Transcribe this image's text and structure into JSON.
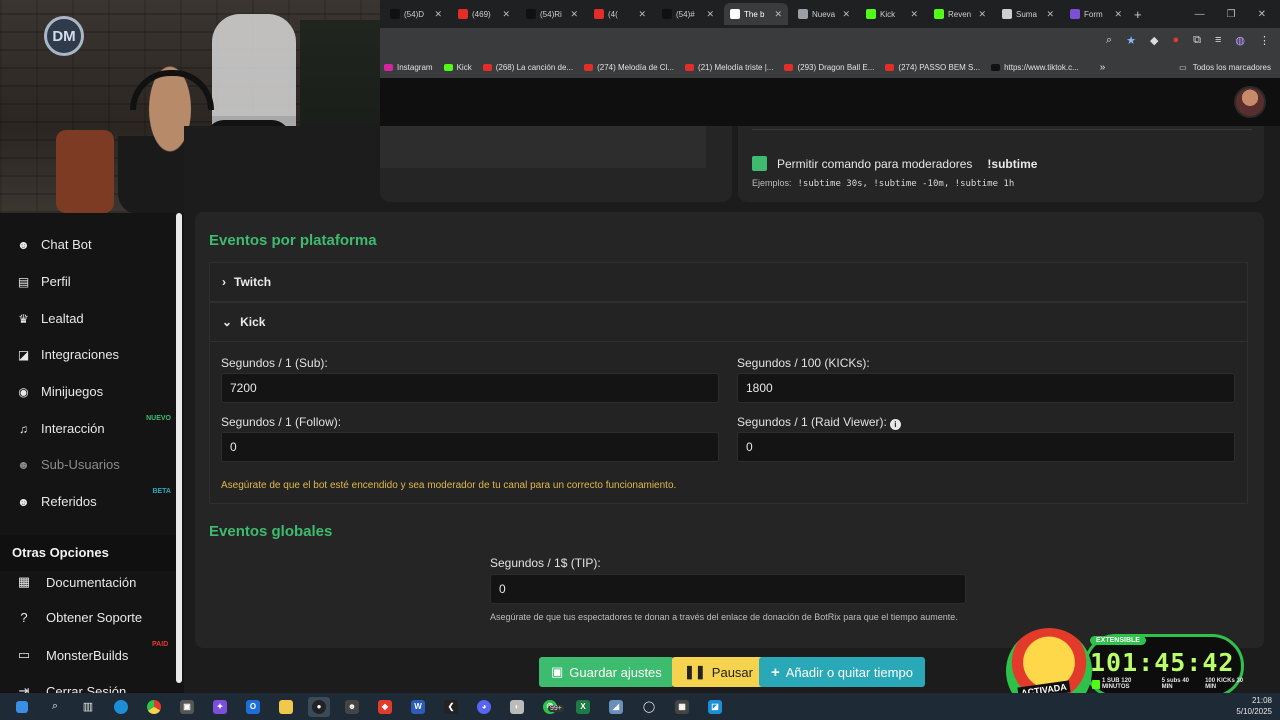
{
  "browser": {
    "tabs": [
      {
        "label": "(54)D",
        "color": "#111111",
        "icon": "tiktok-icon"
      },
      {
        "label": "(469)",
        "color": "#e52d27",
        "icon": "youtube-icon"
      },
      {
        "label": "(54)Ri",
        "color": "#111111",
        "icon": "tiktok-icon"
      },
      {
        "label": "(4(",
        "color": "#e52d27",
        "icon": "youtube-icon"
      },
      {
        "label": "(54)#",
        "color": "#111111",
        "icon": "tiktok-icon"
      },
      {
        "label": "The b",
        "color": "#ffffff",
        "icon": "botrix-icon",
        "active": true
      },
      {
        "label": "Nueva",
        "color": "#9aa0a6",
        "icon": "chrome-icon"
      },
      {
        "label": "Kick",
        "color": "#53fc18",
        "icon": "kick-icon"
      },
      {
        "label": "Reven",
        "color": "#53fc18",
        "icon": "kick-icon"
      },
      {
        "label": "Suma",
        "color": "#cfcfcf",
        "icon": "openai-icon"
      },
      {
        "label": "Form",
        "color": "#7b4fd6",
        "icon": "forms-icon"
      }
    ],
    "bookmarks": [
      {
        "label": "Instagram",
        "color": "#d6249f"
      },
      {
        "label": "Kick",
        "color": "#53fc18"
      },
      {
        "label": "(268) La canción de...",
        "color": "#e52d27"
      },
      {
        "label": "(274) Melodía de Cl...",
        "color": "#e52d27"
      },
      {
        "label": "(21) Melodía triste |...",
        "color": "#e52d27"
      },
      {
        "label": "(293) Dragon Ball E...",
        "color": "#e52d27"
      },
      {
        "label": "(274) PASSO BEM S...",
        "color": "#e52d27"
      },
      {
        "label": "https://www.tiktok.c...",
        "color": "#111111"
      }
    ],
    "all_bookmarks": "Todos los marcadores",
    "more_bookmarks": "»"
  },
  "webcam": {
    "logo_text": "DM"
  },
  "sidebar": {
    "items": [
      {
        "label": "Chat Bot",
        "icon": "robot-icon",
        "glyph": "☻"
      },
      {
        "label": "Perfil",
        "icon": "id-card-icon",
        "glyph": "▤"
      },
      {
        "label": "Lealtad",
        "icon": "trophy-icon",
        "glyph": "♛"
      },
      {
        "label": "Integraciones",
        "icon": "integration-icon",
        "glyph": "◪"
      },
      {
        "label": "Minijuegos",
        "icon": "gamepad-icon",
        "glyph": "◉"
      },
      {
        "label": "Interacción",
        "icon": "music-icon",
        "glyph": "♫",
        "badge": "NUEVO",
        "badge_color": "#3dbb6e"
      },
      {
        "label": "Sub-Usuarios",
        "icon": "users-icon",
        "glyph": "☻",
        "disabled": true
      },
      {
        "label": "Referidos",
        "icon": "users-icon",
        "glyph": "☻",
        "badge": "BETA",
        "badge_color": "#29a8b8"
      }
    ],
    "other_options_title": "Otras Opciones",
    "other_options": [
      {
        "label": "Documentación",
        "icon": "document-icon",
        "glyph": "▦"
      },
      {
        "label": "Obtener Soporte",
        "icon": "help-icon",
        "glyph": "?"
      },
      {
        "label": "MonsterBuilds",
        "icon": "monitor-icon",
        "glyph": "▭",
        "badge": "PAID",
        "badge_color": "#e33b2b"
      },
      {
        "label": "Cerrar Sesión",
        "icon": "logout-icon",
        "glyph": "⇥"
      }
    ]
  },
  "moderator": {
    "checkbox_label": "Permitir comando para moderadores",
    "command": "!subtime",
    "examples_label": "Ejemplos:",
    "examples": "!subtime 30s,  !subtime -10m,  !subtime 1h"
  },
  "platform_events": {
    "title": "Eventos por plataforma",
    "twitch_label": "Twitch",
    "kick_label": "Kick",
    "fields": {
      "sub_label": "Segundos / 1 (Sub):",
      "sub_value": "7200",
      "kicks_label": "Segundos / 100 (KICKs):",
      "kicks_value": "1800",
      "follow_label": "Segundos / 1 (Follow):",
      "follow_value": "0",
      "raid_label": "Segundos / 1 (Raid Viewer):",
      "raid_value": "0"
    },
    "warning": "Asegúrate de que el bot esté encendido y sea moderador de tu canal para un correcto funcionamiento."
  },
  "global_events": {
    "title": "Eventos globales",
    "tip_label": "Segundos / 1$ (TIP):",
    "tip_value": "0",
    "note": "Asegúrate de que tus espectadores te donan a través del enlace de donación de BotRix para que el tiempo aumente."
  },
  "actions": {
    "save": "Guardar ajustes",
    "pause": "Pausar",
    "add_time": "Añadir o quitar tiempo"
  },
  "timer": {
    "extensible": "EXTENSIBLE",
    "time": "101:45:42",
    "stat1": "1 SUB 120 MINUTOS",
    "stat2": "5 subs 40 MIN",
    "stat3": "100 KICKs 30 MIN",
    "mascot_label": "ACTIVADA"
  },
  "taskbar": {
    "time": "21:08",
    "date": "5/10/2025",
    "badge": "99+"
  }
}
